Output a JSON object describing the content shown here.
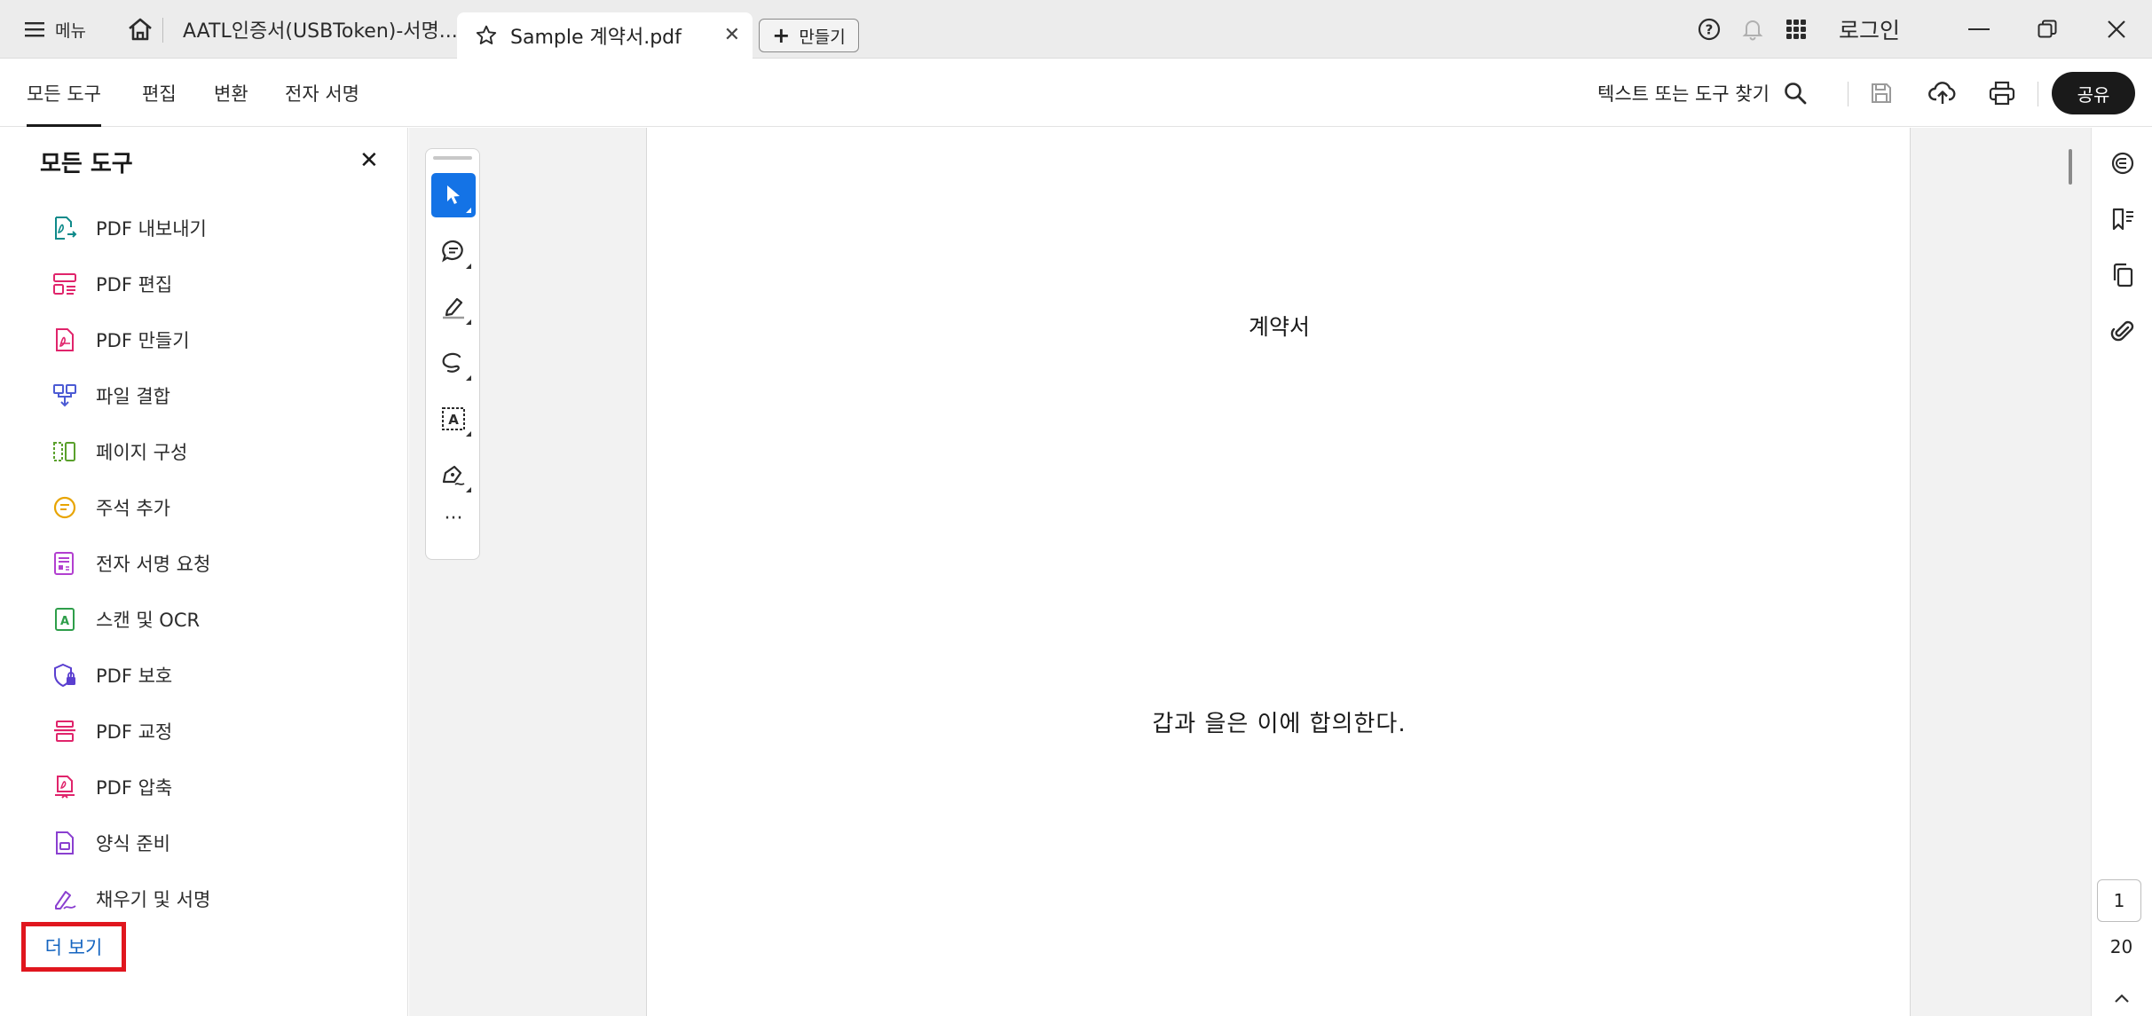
{
  "tabbar": {
    "menu_label": "메뉴",
    "tab1_title": "AATL인증서(USBToken)-서명...",
    "tab2_title": "Sample 계약서.pdf",
    "create_label": "만들기",
    "login_label": "로그인"
  },
  "toolbar": {
    "tabs": [
      "모든 도구",
      "편집",
      "변환",
      "전자 서명"
    ],
    "find_label": "텍스트 또는 도구 찾기",
    "share_label": "공유"
  },
  "left_panel": {
    "title": "모든 도구",
    "items": [
      {
        "label": "PDF 내보내기",
        "icon": "export-pdf-icon",
        "color": "#0e8a8a"
      },
      {
        "label": "PDF 편집",
        "icon": "edit-pdf-icon",
        "color": "#e0246b"
      },
      {
        "label": "PDF 만들기",
        "icon": "create-pdf-icon",
        "color": "#e0246b"
      },
      {
        "label": "파일 결합",
        "icon": "combine-files-icon",
        "color": "#4c5bd4"
      },
      {
        "label": "페이지 구성",
        "icon": "organize-pages-icon",
        "color": "#5aa02c"
      },
      {
        "label": "주석 추가",
        "icon": "comment-icon",
        "color": "#e8a400"
      },
      {
        "label": "전자 서명 요청",
        "icon": "request-esign-icon",
        "color": "#b23fd0"
      },
      {
        "label": "스캔 및 OCR",
        "icon": "scan-ocr-icon",
        "color": "#2e9e4a"
      },
      {
        "label": "PDF 보호",
        "icon": "protect-pdf-icon",
        "color": "#5a3fd0"
      },
      {
        "label": "PDF 교정",
        "icon": "redact-pdf-icon",
        "color": "#e0246b"
      },
      {
        "label": "PDF 압축",
        "icon": "compress-pdf-icon",
        "color": "#e0246b"
      },
      {
        "label": "양식 준비",
        "icon": "prepare-form-icon",
        "color": "#8a3fd0"
      },
      {
        "label": "채우기 및 서명",
        "icon": "fill-sign-icon",
        "color": "#8a3fd0"
      }
    ],
    "more_label": "더 보기"
  },
  "document": {
    "title": "계약서",
    "body": "갑과 을은 이에 합의한다."
  },
  "pagination": {
    "current": "1",
    "total": "20"
  }
}
